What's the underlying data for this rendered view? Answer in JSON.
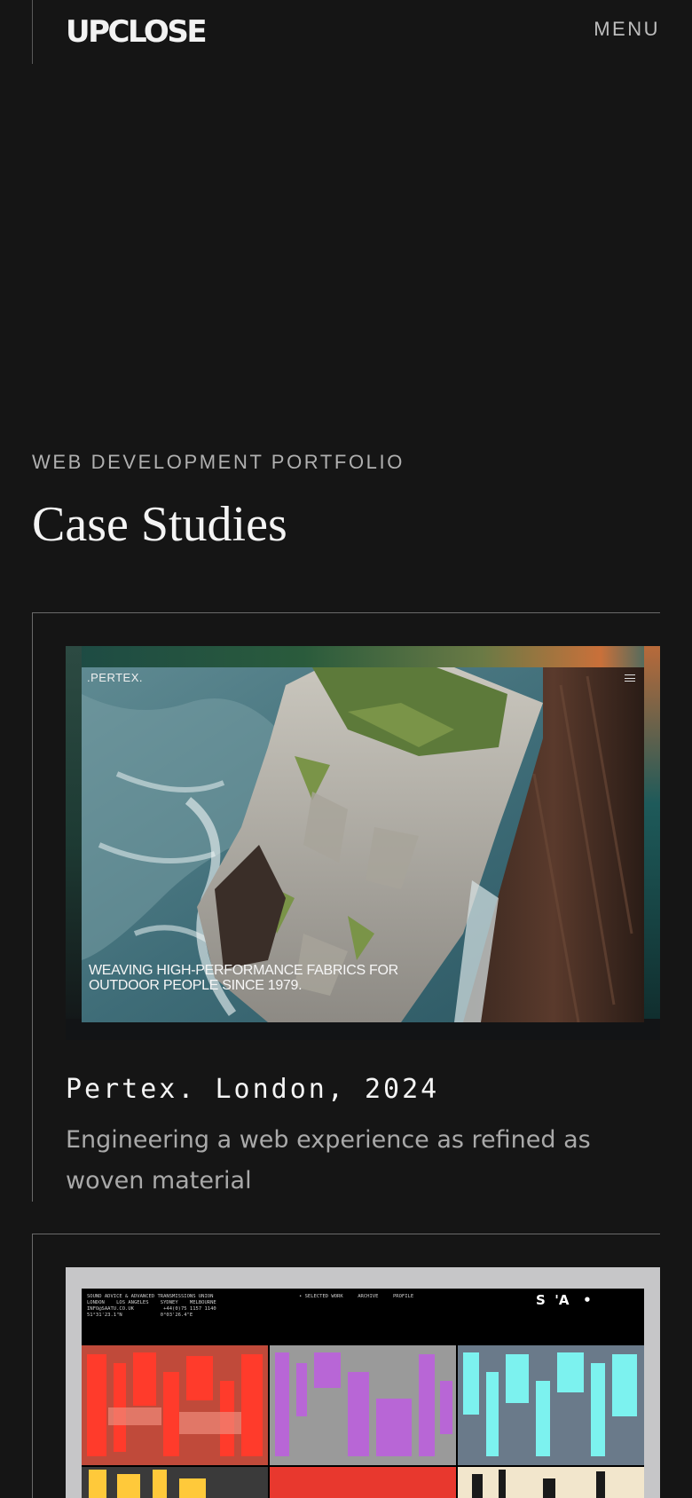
{
  "header": {
    "logo": "UPCLOSE",
    "menu_label": "MENU"
  },
  "hero": {
    "eyebrow": "WEB DEVELOPMENT PORTFOLIO",
    "title": "Case Studies"
  },
  "cases": [
    {
      "image": {
        "brand": ".PERTEX.",
        "tagline": "Weaving high-performance fabrics for outdoor people since 1979."
      },
      "title": "Pertex. London, 2024",
      "description": "Engineering a web experience as refined as woven material"
    },
    {
      "image": {
        "meta": "SOUND ADVICE & ADVANCED TRANSMISSIONS UNION\nLONDON    LOS ANGELES    SYDNEY    MELBOURNE\nINFO@SAATU.CO.UK          +44(0)75 1157 1140\n51°31'23.1\"N             0°03'26.4\"E",
        "nav": "• SELECTED WORK     ARCHIVE     PROFILE",
        "logo": "S  'A   •"
      }
    }
  ],
  "colors": {
    "background": "#151515",
    "rule": "#6a6a6a",
    "text_primary": "#f4f4f4",
    "text_muted": "#a9a9a9"
  }
}
